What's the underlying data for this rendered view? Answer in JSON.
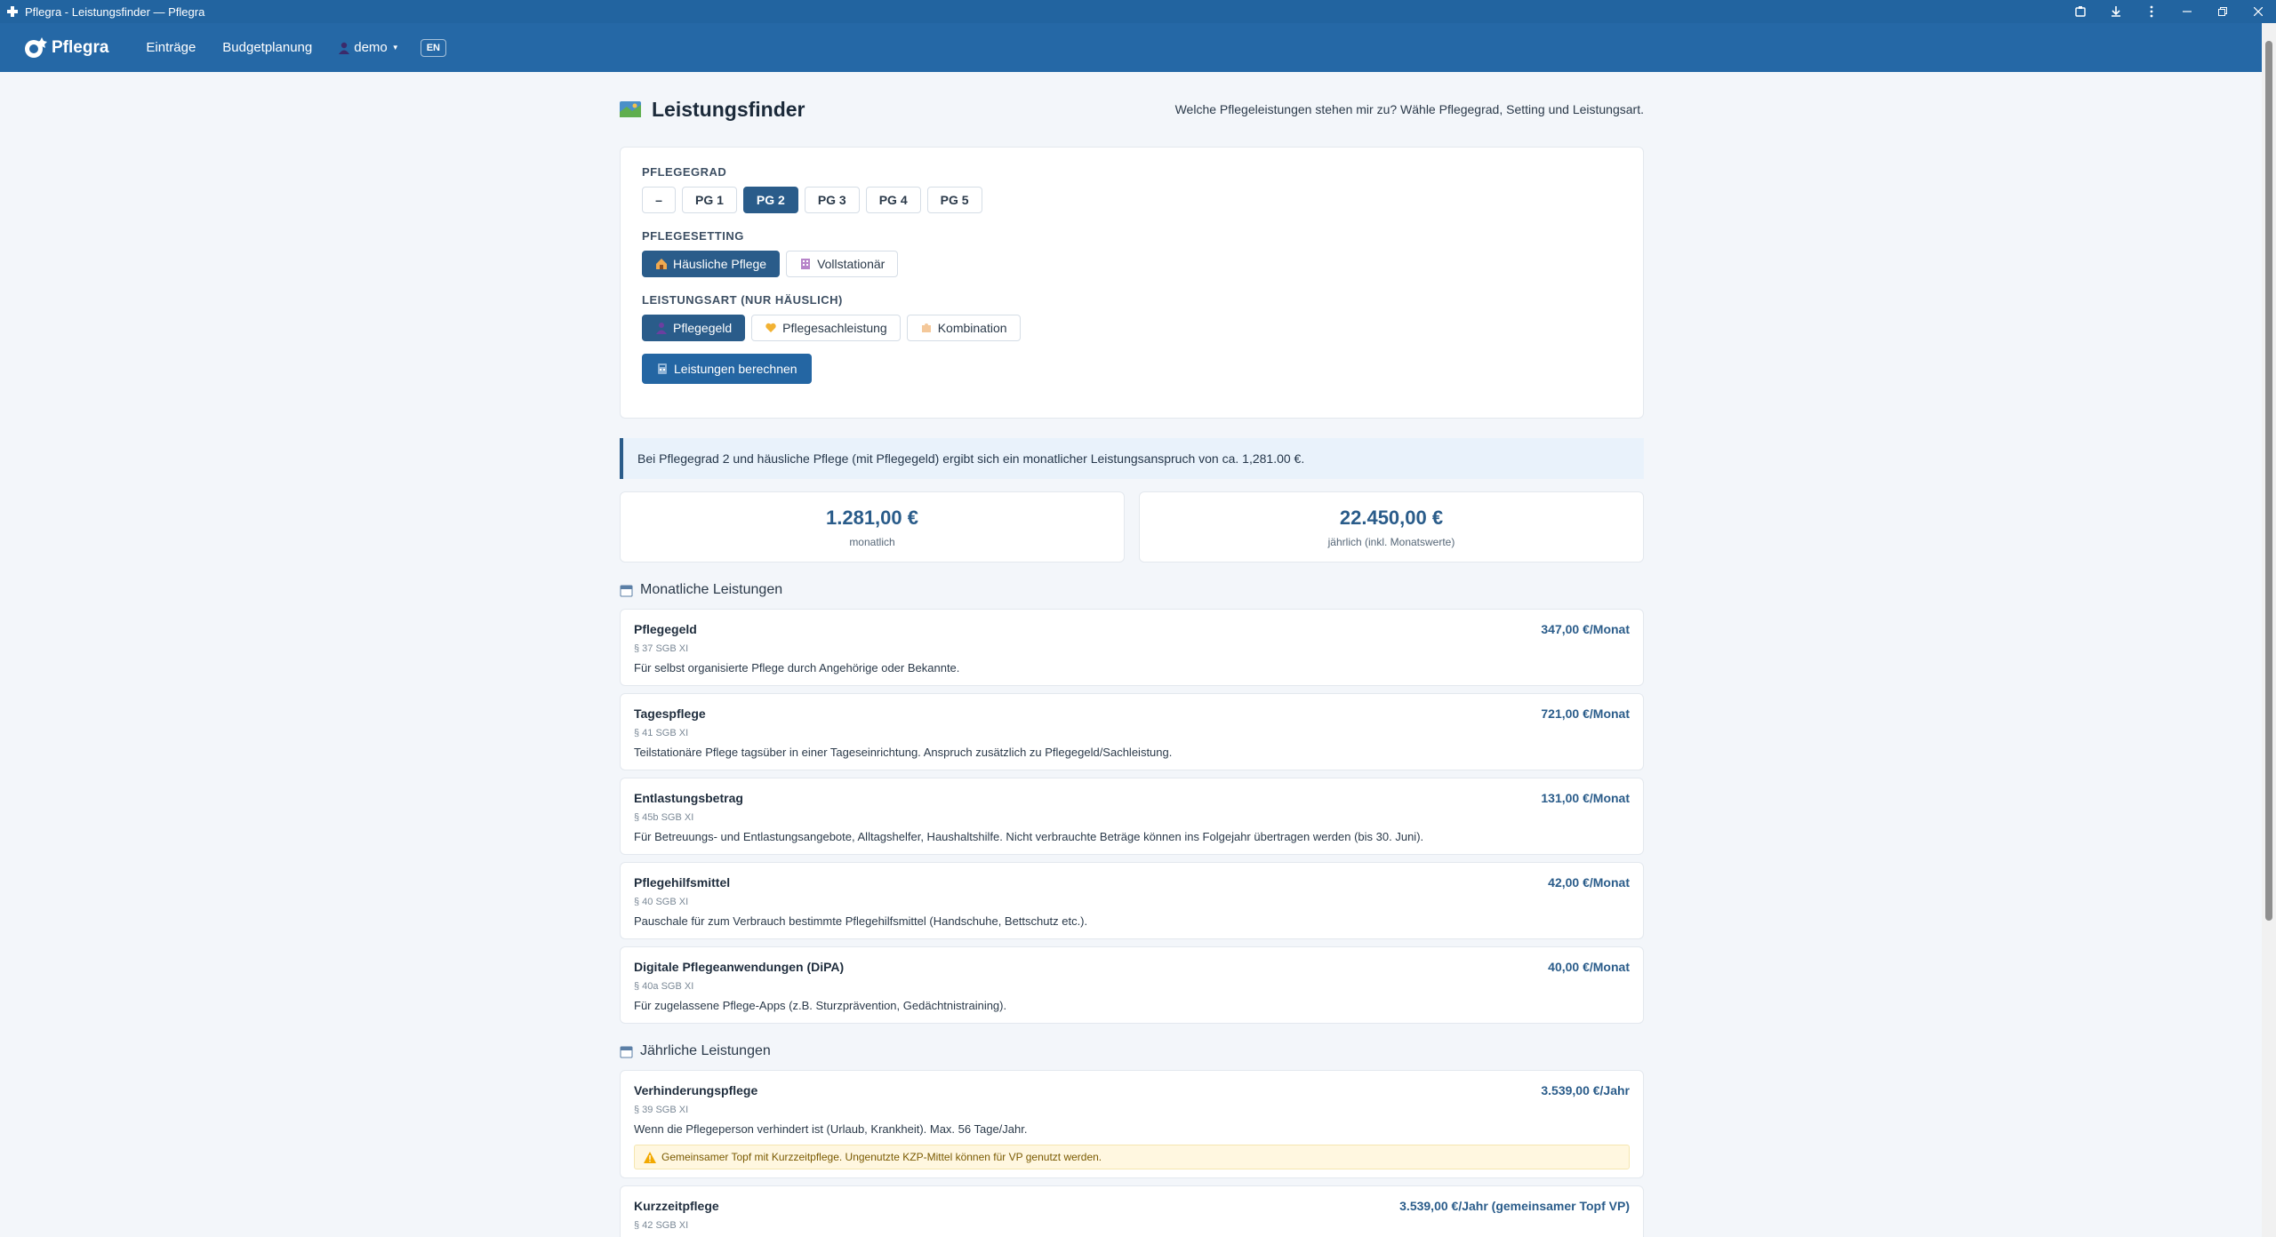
{
  "window": {
    "title": "Pflegra - Leistungsfinder — Pflegra"
  },
  "nav": {
    "brand": "Pflegra",
    "links": [
      "Einträge",
      "Budgetplanung"
    ],
    "user": "demo",
    "language": "EN"
  },
  "page": {
    "title": "Leistungsfinder",
    "subtitle": "Welche Pflegeleistungen stehen mir zu? Wähle Pflegegrad, Setting und Leistungsart."
  },
  "form": {
    "pflegegrad": {
      "label": "PFLEGEGRAD",
      "options": [
        "–",
        "PG 1",
        "PG 2",
        "PG 3",
        "PG 4",
        "PG 5"
      ],
      "selected": "PG 2"
    },
    "setting": {
      "label": "PFLEGESETTING",
      "options": [
        "Häusliche Pflege",
        "Vollstationär"
      ],
      "selected": "Häusliche Pflege"
    },
    "leistungsart": {
      "label": "LEISTUNGSART (NUR HÄUSLICH)",
      "options": [
        "Pflegegeld",
        "Pflegesachleistung",
        "Kombination"
      ],
      "selected": "Pflegegeld"
    },
    "submit_label": "Leistungen berechnen"
  },
  "result": {
    "info": "Bei Pflegegrad 2 und häusliche Pflege (mit Pflegegeld) ergibt sich ein monatlicher Leistungsanspruch von ca. 1,281.00 €.",
    "monthly_value": "1.281,00 €",
    "monthly_label": "monatlich",
    "yearly_value": "22.450,00 €",
    "yearly_label": "jährlich (inkl. Monatswerte)"
  },
  "monthly": {
    "heading": "Monatliche Leistungen",
    "items": [
      {
        "title": "Pflegegeld",
        "amount": "347,00 €/Monat",
        "law": "§ 37 SGB XI",
        "desc": "Für selbst organisierte Pflege durch Angehörige oder Bekannte."
      },
      {
        "title": "Tagespflege",
        "amount": "721,00 €/Monat",
        "law": "§ 41 SGB XI",
        "desc": "Teilstationäre Pflege tagsüber in einer Tageseinrichtung. Anspruch zusätzlich zu Pflegegeld/Sachleistung."
      },
      {
        "title": "Entlastungsbetrag",
        "amount": "131,00 €/Monat",
        "law": "§ 45b SGB XI",
        "desc": "Für Betreuungs- und Entlastungsangebote, Alltagshelfer, Haushaltshilfe. Nicht verbrauchte Beträge können ins Folgejahr übertragen werden (bis 30. Juni)."
      },
      {
        "title": "Pflegehilfsmittel",
        "amount": "42,00 €/Monat",
        "law": "§ 40 SGB XI",
        "desc": "Pauschale für zum Verbrauch bestimmte Pflegehilfsmittel (Handschuhe, Bettschutz etc.)."
      },
      {
        "title": "Digitale Pflegeanwendungen (DiPA)",
        "amount": "40,00 €/Monat",
        "law": "§ 40a SGB XI",
        "desc": "Für zugelassene Pflege-Apps (z.B. Sturzprävention, Gedächtnistraining)."
      }
    ]
  },
  "yearly": {
    "heading": "Jährliche Leistungen",
    "items": [
      {
        "title": "Verhinderungspflege",
        "amount": "3.539,00 €/Jahr",
        "law": "§ 39 SGB XI",
        "desc": "Wenn die Pflegeperson verhindert ist (Urlaub, Krankheit). Max. 56 Tage/Jahr.",
        "warning": "Gemeinsamer Topf mit Kurzzeitpflege. Ungenutzte KZP-Mittel können für VP genutzt werden."
      },
      {
        "title": "Kurzzeitpflege",
        "amount": "3.539,00 €/Jahr (gemeinsamer Topf VP)",
        "law": "§ 42 SGB XI"
      }
    ]
  },
  "colors": {
    "titlebar": "#2264a0",
    "navbar": "#2568a6",
    "accent": "#2a5c8a",
    "background": "#f3f6fa"
  }
}
